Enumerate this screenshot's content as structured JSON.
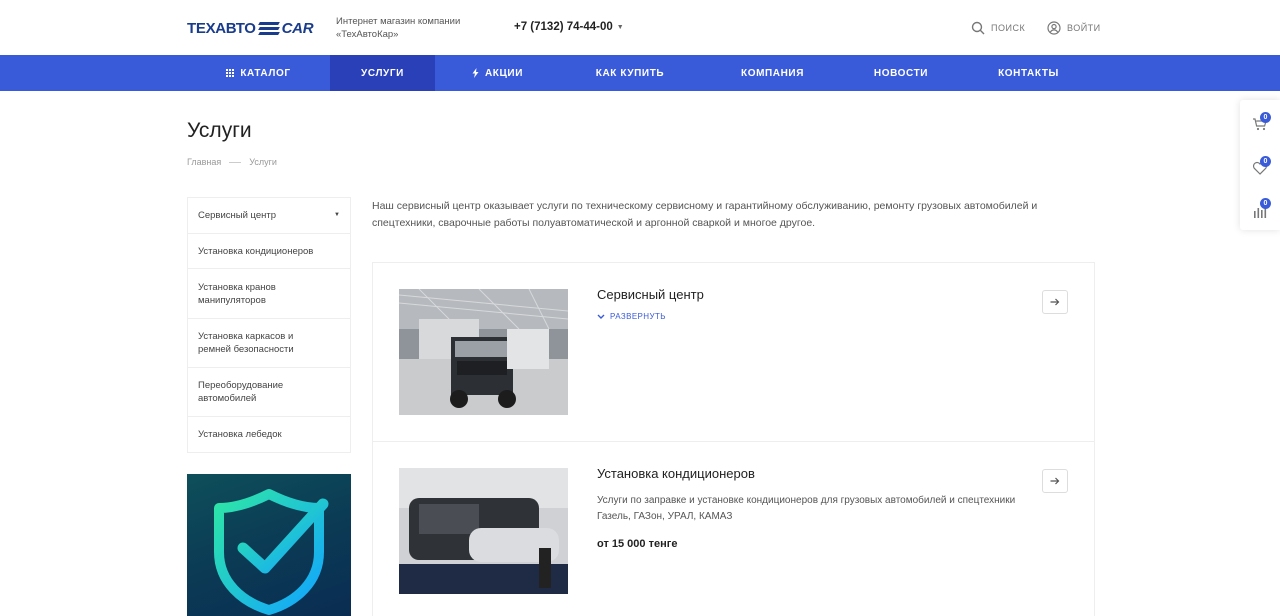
{
  "header": {
    "logo_text_1": "ТЕХАВТО",
    "logo_text_2": "CAR",
    "tagline": "Интернет магазин компании «ТехАвтоКар»",
    "phone": "+7 (7132) 74-44-00",
    "search_label": "поиск",
    "login_label": "войти"
  },
  "nav": {
    "items": [
      {
        "label": "Каталог",
        "icon": "grid-icon"
      },
      {
        "label": "Услуги"
      },
      {
        "label": "Акции",
        "icon": "lightning-icon"
      },
      {
        "label": "Как купить"
      },
      {
        "label": "Компания"
      },
      {
        "label": "Новости"
      },
      {
        "label": "Контакты"
      }
    ],
    "active": "Услуги"
  },
  "side_widgets": [
    {
      "icon": "cart-icon",
      "count": "0"
    },
    {
      "icon": "heart-icon",
      "count": "0"
    },
    {
      "icon": "compare-icon",
      "count": "0"
    }
  ],
  "page": {
    "title": "Услуги",
    "breadcrumb": [
      "Главная",
      "Услуги"
    ]
  },
  "sidebar": {
    "items": [
      {
        "label": "Сервисный центр"
      },
      {
        "label": "Установка кондиционеров"
      },
      {
        "label": "Установка кранов манипуляторов"
      },
      {
        "label": "Установка каркасов и ремней безопасности"
      },
      {
        "label": "Переоборудование автомобилей"
      },
      {
        "label": "Установка лебедок"
      }
    ]
  },
  "intro": "Наш сервисный центр оказывает услуги по техническому сервисному и гарантийному обслуживанию, ремонту грузовых автомобилей и спецтехники, сварочные работы полуавтоматической и аргонной сваркой и многое другое.",
  "cards": [
    {
      "title": "Сервисный центр",
      "expand_label": "развернуть"
    },
    {
      "title": "Установка кондиционеров",
      "description": "Услуги по заправке и установке кондиционеров для грузовых автомобилей и спецтехники Газель, ГАЗон, УРАЛ, КАМАЗ",
      "price": "от 15 000 тенге"
    }
  ],
  "colors": {
    "accent": "#3a5bd9",
    "nav_active": "#2940b8",
    "logo": "#1a3c8c"
  }
}
